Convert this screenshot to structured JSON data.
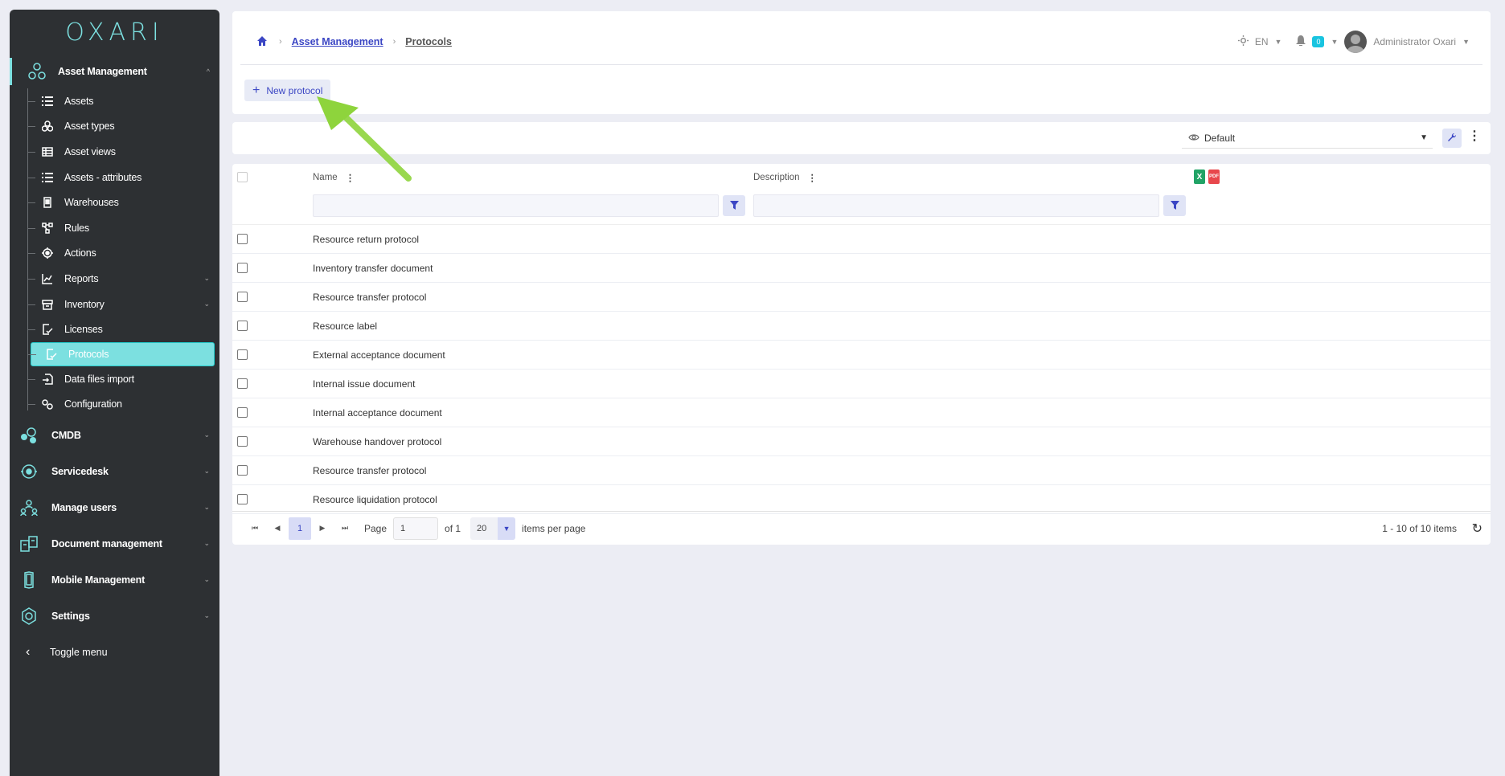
{
  "brand": {
    "logo_text": "OXARI",
    "accent": "#7ce0e0"
  },
  "sidebar": {
    "asset_management": {
      "label": "Asset Management",
      "icon": "asset-management-icon"
    },
    "sub_items": [
      {
        "label": "Assets",
        "icon": "list-icon"
      },
      {
        "label": "Asset types",
        "icon": "shapes-icon"
      },
      {
        "label": "Asset views",
        "icon": "table-icon"
      },
      {
        "label": "Assets - attributes",
        "icon": "list-icon"
      },
      {
        "label": "Warehouses",
        "icon": "building-icon"
      },
      {
        "label": "Rules",
        "icon": "rules-icon"
      },
      {
        "label": "Actions",
        "icon": "target-icon"
      },
      {
        "label": "Reports",
        "icon": "chart-icon",
        "has_children": true
      },
      {
        "label": "Inventory",
        "icon": "box-icon",
        "has_children": true
      },
      {
        "label": "Licenses",
        "icon": "license-icon"
      },
      {
        "label": "Protocols",
        "icon": "protocol-icon",
        "active": true
      },
      {
        "label": "Data files import",
        "icon": "import-icon"
      },
      {
        "label": "Configuration",
        "icon": "gears-icon"
      }
    ],
    "main_items": [
      {
        "label": "CMDB",
        "icon": "cmdb-icon"
      },
      {
        "label": "Servicedesk",
        "icon": "servicedesk-icon"
      },
      {
        "label": "Manage users",
        "icon": "users-icon"
      },
      {
        "label": "Document management",
        "icon": "documents-icon"
      },
      {
        "label": "Mobile Management",
        "icon": "mobile-icon"
      },
      {
        "label": "Settings",
        "icon": "settings-icon"
      }
    ],
    "toggle_label": "Toggle menu"
  },
  "header": {
    "breadcrumb": {
      "parent": "Asset Management",
      "current": "Protocols"
    },
    "language": "EN",
    "notifications_count": "0",
    "user_name": "Administrator Oxari",
    "new_button_label": "New protocol"
  },
  "toolbar": {
    "view_label": "Default"
  },
  "table": {
    "columns": {
      "name": "Name",
      "description": "Description"
    },
    "rows": [
      "Resource return protocol",
      "Inventory transfer document",
      "Resource transfer protocol",
      "Resource label",
      "External acceptance document",
      "Internal issue document",
      "Internal acceptance document",
      "Warehouse handover protocol",
      "Resource transfer protocol",
      "Resource liquidation protocol"
    ]
  },
  "pager": {
    "current_page": "1",
    "page_label": "Page",
    "page_input": "1",
    "of_label": "of 1",
    "page_size": "20",
    "per_page_label": "items per page",
    "info": "1 - 10 of 10 items"
  }
}
